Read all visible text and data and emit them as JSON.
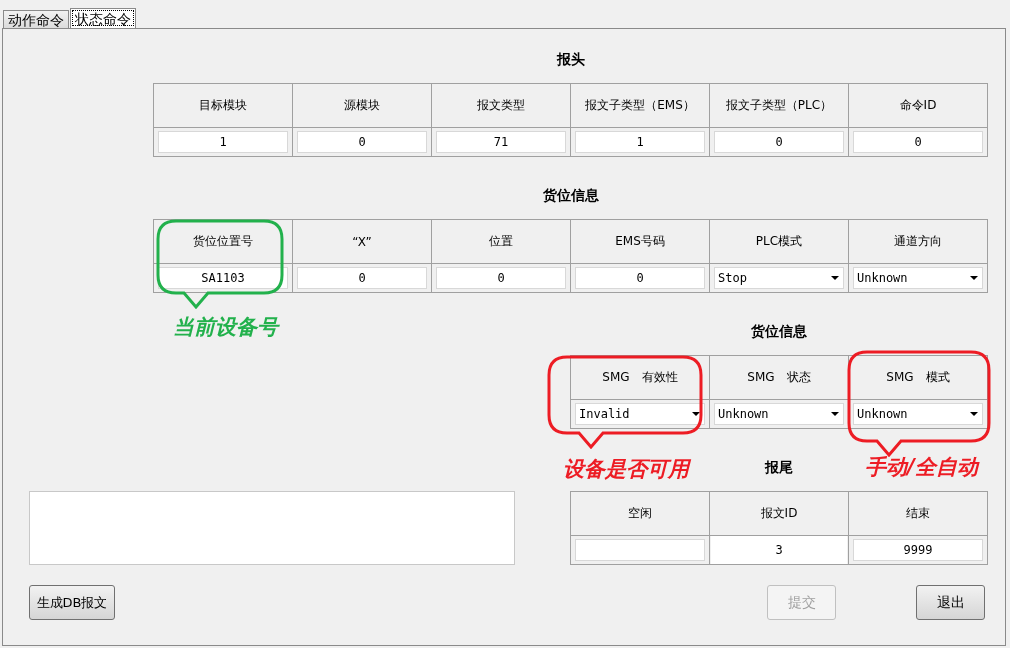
{
  "tabs": [
    {
      "label": "动作命令",
      "selected": false
    },
    {
      "label": "状态命令",
      "selected": true
    }
  ],
  "sections": [
    {
      "title": "报头",
      "columns": [
        {
          "header": "目标模块",
          "kind": "text",
          "value": "1"
        },
        {
          "header": "源模块",
          "kind": "text",
          "value": "0"
        },
        {
          "header": "报文类型",
          "kind": "text",
          "value": "71"
        },
        {
          "header": "报文子类型（EMS）",
          "kind": "text",
          "value": "1"
        },
        {
          "header": "报文子类型（PLC）",
          "kind": "text",
          "value": "0"
        },
        {
          "header": "命令ID",
          "kind": "text",
          "value": "0"
        }
      ]
    },
    {
      "title": "货位信息",
      "columns": [
        {
          "header": "货位位置号",
          "kind": "text",
          "value": "SA1103"
        },
        {
          "header": "“X”",
          "kind": "text",
          "value": "0"
        },
        {
          "header": "位置",
          "kind": "text",
          "value": "0"
        },
        {
          "header": "EMS号码",
          "kind": "text",
          "value": "0"
        },
        {
          "header": "PLC模式",
          "kind": "dropdown",
          "value": "Stop"
        },
        {
          "header": "通道方向",
          "kind": "dropdown",
          "value": "Unknown"
        }
      ]
    },
    {
      "title": "货位信息",
      "columns": [
        {
          "header": "SMG　有效性",
          "kind": "dropdown",
          "value": "Invalid"
        },
        {
          "header": "SMG　状态",
          "kind": "dropdown",
          "value": "Unknown"
        },
        {
          "header": "SMG　模式",
          "kind": "dropdown",
          "value": "Unknown"
        }
      ]
    },
    {
      "title": "报尾",
      "columns": [
        {
          "header": "空闲",
          "kind": "text"
        },
        {
          "header": "报文ID",
          "kind": "plain",
          "value": "3"
        },
        {
          "header": "结束",
          "kind": "text",
          "value": "9999"
        }
      ]
    }
  ],
  "annotations": [
    {
      "text": "当前设备号",
      "color": "#22b14c"
    },
    {
      "text": "设备是否可用",
      "color": "#ed1c24"
    },
    {
      "text": "手动/全自动",
      "color": "#ed1c24"
    }
  ],
  "buttons": [
    {
      "label": "生成DB报文",
      "disabled": false
    },
    {
      "label": "提交",
      "disabled": true
    },
    {
      "label": "退出",
      "disabled": false
    }
  ]
}
